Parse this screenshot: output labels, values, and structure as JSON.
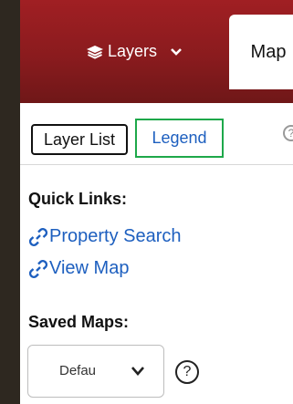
{
  "header": {
    "layers_label": "Layers",
    "map_tab_label": "Map",
    "accent_color": "#8a1b1e"
  },
  "tabs": {
    "layer_list_label": "Layer List",
    "legend_label": "Legend",
    "legend_border_color": "#1ea84a"
  },
  "quick_links": {
    "title": "Quick Links:",
    "items": [
      {
        "label": "Property Search",
        "icon": "link-icon"
      },
      {
        "label": "View Map",
        "icon": "link-icon"
      }
    ],
    "link_color": "#1d5fbf"
  },
  "saved_maps": {
    "title": "Saved Maps:",
    "selected_value": "Defau",
    "help_symbol": "?"
  }
}
